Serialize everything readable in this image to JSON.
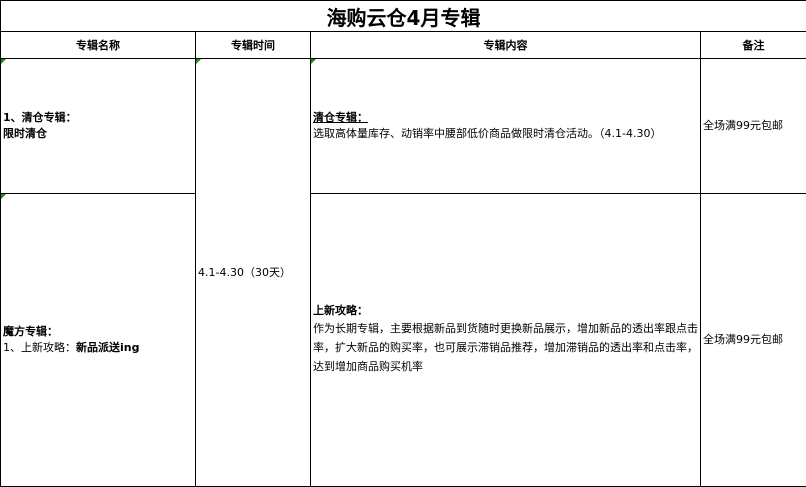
{
  "title": "海购云仓4月专辑",
  "headers": [
    "专辑名称",
    "专辑时间",
    "专辑内容",
    "备注"
  ],
  "rows": [
    {
      "name_line1": "1、清仓专辑：",
      "name_line2": "限时清仓",
      "content_heading": "清仓专辑：",
      "content_body": "选取高体量库存、动销率中腰部低价商品做限时清仓活动。（4.1-4.30）",
      "note": "全场满99元包邮"
    },
    {
      "name_line1": "魔方专辑：",
      "name_line2_prefix": "1、上新攻略：",
      "name_line2_bold": "新品派送ing",
      "content_heading": "上新攻略：",
      "content_body": "作为长期专辑，主要根据新品到货随时更换新品展示，增加新品的透出率跟点击率，扩大新品的购买率，也可展示滞销品推荐，增加滞销品的透出率和点击率，达到增加商品购买机率",
      "note": "全场满99元包邮"
    }
  ],
  "period": "4.1-4.30（30天）"
}
